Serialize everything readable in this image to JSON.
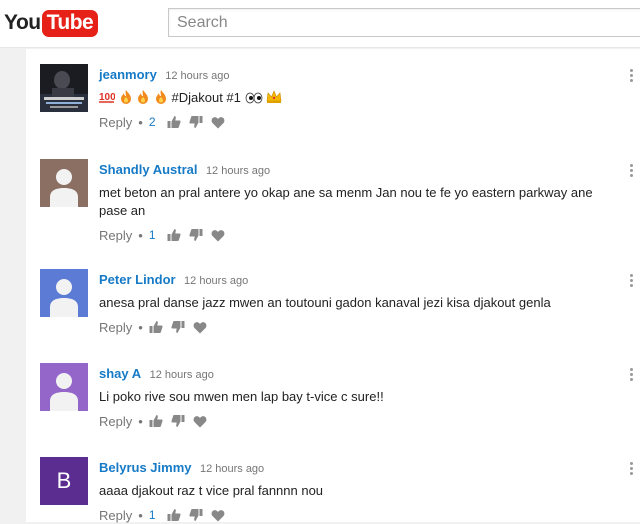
{
  "header": {
    "logo_you": "You",
    "logo_tube": "Tube",
    "search_placeholder": "Search"
  },
  "colors": {
    "author_link": "#167ac6",
    "brand_red": "#e62117",
    "avatar_default": "#8b6f63"
  },
  "comments": [
    {
      "author": "jeanmory",
      "time": "12 hours ago",
      "text_suffix": "#Djakout #1",
      "emoji_prefix": [
        "100-icon",
        "fire-icon",
        "fire-icon",
        "fire-icon"
      ],
      "emoji_suffix": [
        "eyes-icon",
        "crown-icon"
      ],
      "reply_label": "Reply",
      "reply_count": "2",
      "avatar": "photo"
    },
    {
      "author": "Shandly Austral",
      "time": "12 hours ago",
      "text": "met beton an pral  antere yo okap ane  sa menm Jan nou te  fe yo eastern parkway ane pase  an",
      "reply_label": "Reply",
      "reply_count": "1",
      "avatar": "silhouette-brown"
    },
    {
      "author": "Peter Lindor",
      "time": "12 hours ago",
      "text": "anesa pral danse jazz mwen an toutouni gadon kanaval jezi kisa djakout genla",
      "reply_label": "Reply",
      "reply_count": "",
      "avatar": "silhouette-blue"
    },
    {
      "author": "shay A",
      "time": "12 hours ago",
      "text": "Li poko rive sou mwen men lap bay t-vice c sure!!",
      "reply_label": "Reply",
      "reply_count": "",
      "avatar": "silhouette-purple"
    },
    {
      "author": "Belyrus Jimmy",
      "time": "12 hours ago",
      "text": "aaaa djakout raz t vice pral fannnn nou",
      "reply_label": "Reply",
      "reply_count": "1",
      "avatar": "letter",
      "avatar_letter": "B"
    }
  ]
}
